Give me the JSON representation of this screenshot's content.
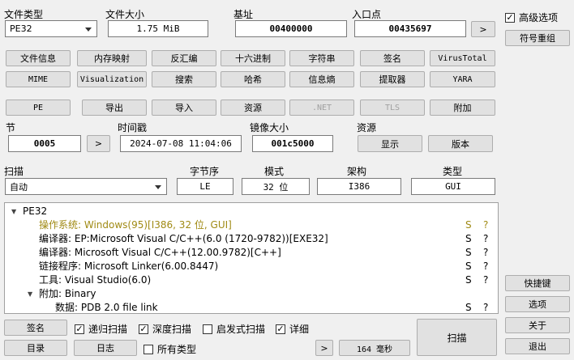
{
  "labels": {
    "file_type": "文件类型",
    "file_size": "文件大小",
    "base_address": "基址",
    "entry_point": "入口点",
    "section": "节",
    "timestamp": "时间戳",
    "image_size": "镜像大小",
    "resources": "资源",
    "scan": "扫描",
    "endianness": "字节序",
    "mode": "模式",
    "arch": "架构",
    "type": "类型"
  },
  "values": {
    "file_type": "PE32",
    "file_size": "1.75 MiB",
    "base_address": "00400000",
    "entry_point": "00435697",
    "section": "0005",
    "timestamp": "2024-07-08 11:04:06",
    "image_size": "001c5000",
    "scan_mode": "自动",
    "endianness": "LE",
    "mode": "32 位",
    "arch": "I386",
    "type": "GUI"
  },
  "buttons": {
    "next": ">",
    "row1": [
      "文件信息",
      "内存映射",
      "反汇编",
      "十六进制",
      "字符串",
      "签名",
      "VirusTotal"
    ],
    "row2": [
      "MIME",
      "Visualization",
      "搜索",
      "哈希",
      "信息熵",
      "提取器",
      "YARA"
    ],
    "row3": [
      "PE",
      "导出",
      "导入",
      "资源",
      ".NET",
      "TLS",
      "附加"
    ],
    "show": "显示",
    "version": "版本",
    "shortcuts": "快捷键",
    "options": "选项",
    "about": "关于",
    "exit": "退出",
    "symbols": "符号重组",
    "signature": "签名",
    "directory": "目录",
    "log": "日志",
    "scan": "扫描",
    "time": "164 毫秒"
  },
  "checks": {
    "advanced": {
      "label": "高级选项",
      "checked": true
    },
    "recursive": {
      "label": "递归扫描",
      "checked": true
    },
    "deep": {
      "label": "深度扫描",
      "checked": true
    },
    "heuristic": {
      "label": "启发式扫描",
      "checked": false
    },
    "verbose": {
      "label": "详细",
      "checked": true
    },
    "all_types": {
      "label": "所有类型",
      "checked": false
    }
  },
  "tree": [
    {
      "text": "PE32",
      "level": 0,
      "toggle": "down",
      "s": "",
      "q": "",
      "olive": false
    },
    {
      "text": "操作系统: Windows(95)[I386, 32 位, GUI]",
      "level": 1,
      "toggle": "",
      "s": "S",
      "q": "?",
      "olive": true
    },
    {
      "text": "编译器: EP:Microsoft Visual C/C++(6.0 (1720-9782))[EXE32]",
      "level": 1,
      "toggle": "",
      "s": "S",
      "q": "?",
      "olive": false
    },
    {
      "text": "编译器: Microsoft Visual C/C++(12.00.9782)[C++]",
      "level": 1,
      "toggle": "",
      "s": "S",
      "q": "?",
      "olive": false
    },
    {
      "text": "链接程序: Microsoft Linker(6.00.8447)",
      "level": 1,
      "toggle": "",
      "s": "S",
      "q": "?",
      "olive": false
    },
    {
      "text": "工具: Visual Studio(6.0)",
      "level": 1,
      "toggle": "",
      "s": "S",
      "q": "?",
      "olive": false
    },
    {
      "text": "附加: Binary",
      "level": 1,
      "toggle": "down",
      "s": "",
      "q": "",
      "olive": false
    },
    {
      "text": "数据: PDB 2.0 file link",
      "level": 2,
      "toggle": "",
      "s": "S",
      "q": "?",
      "olive": false
    }
  ]
}
